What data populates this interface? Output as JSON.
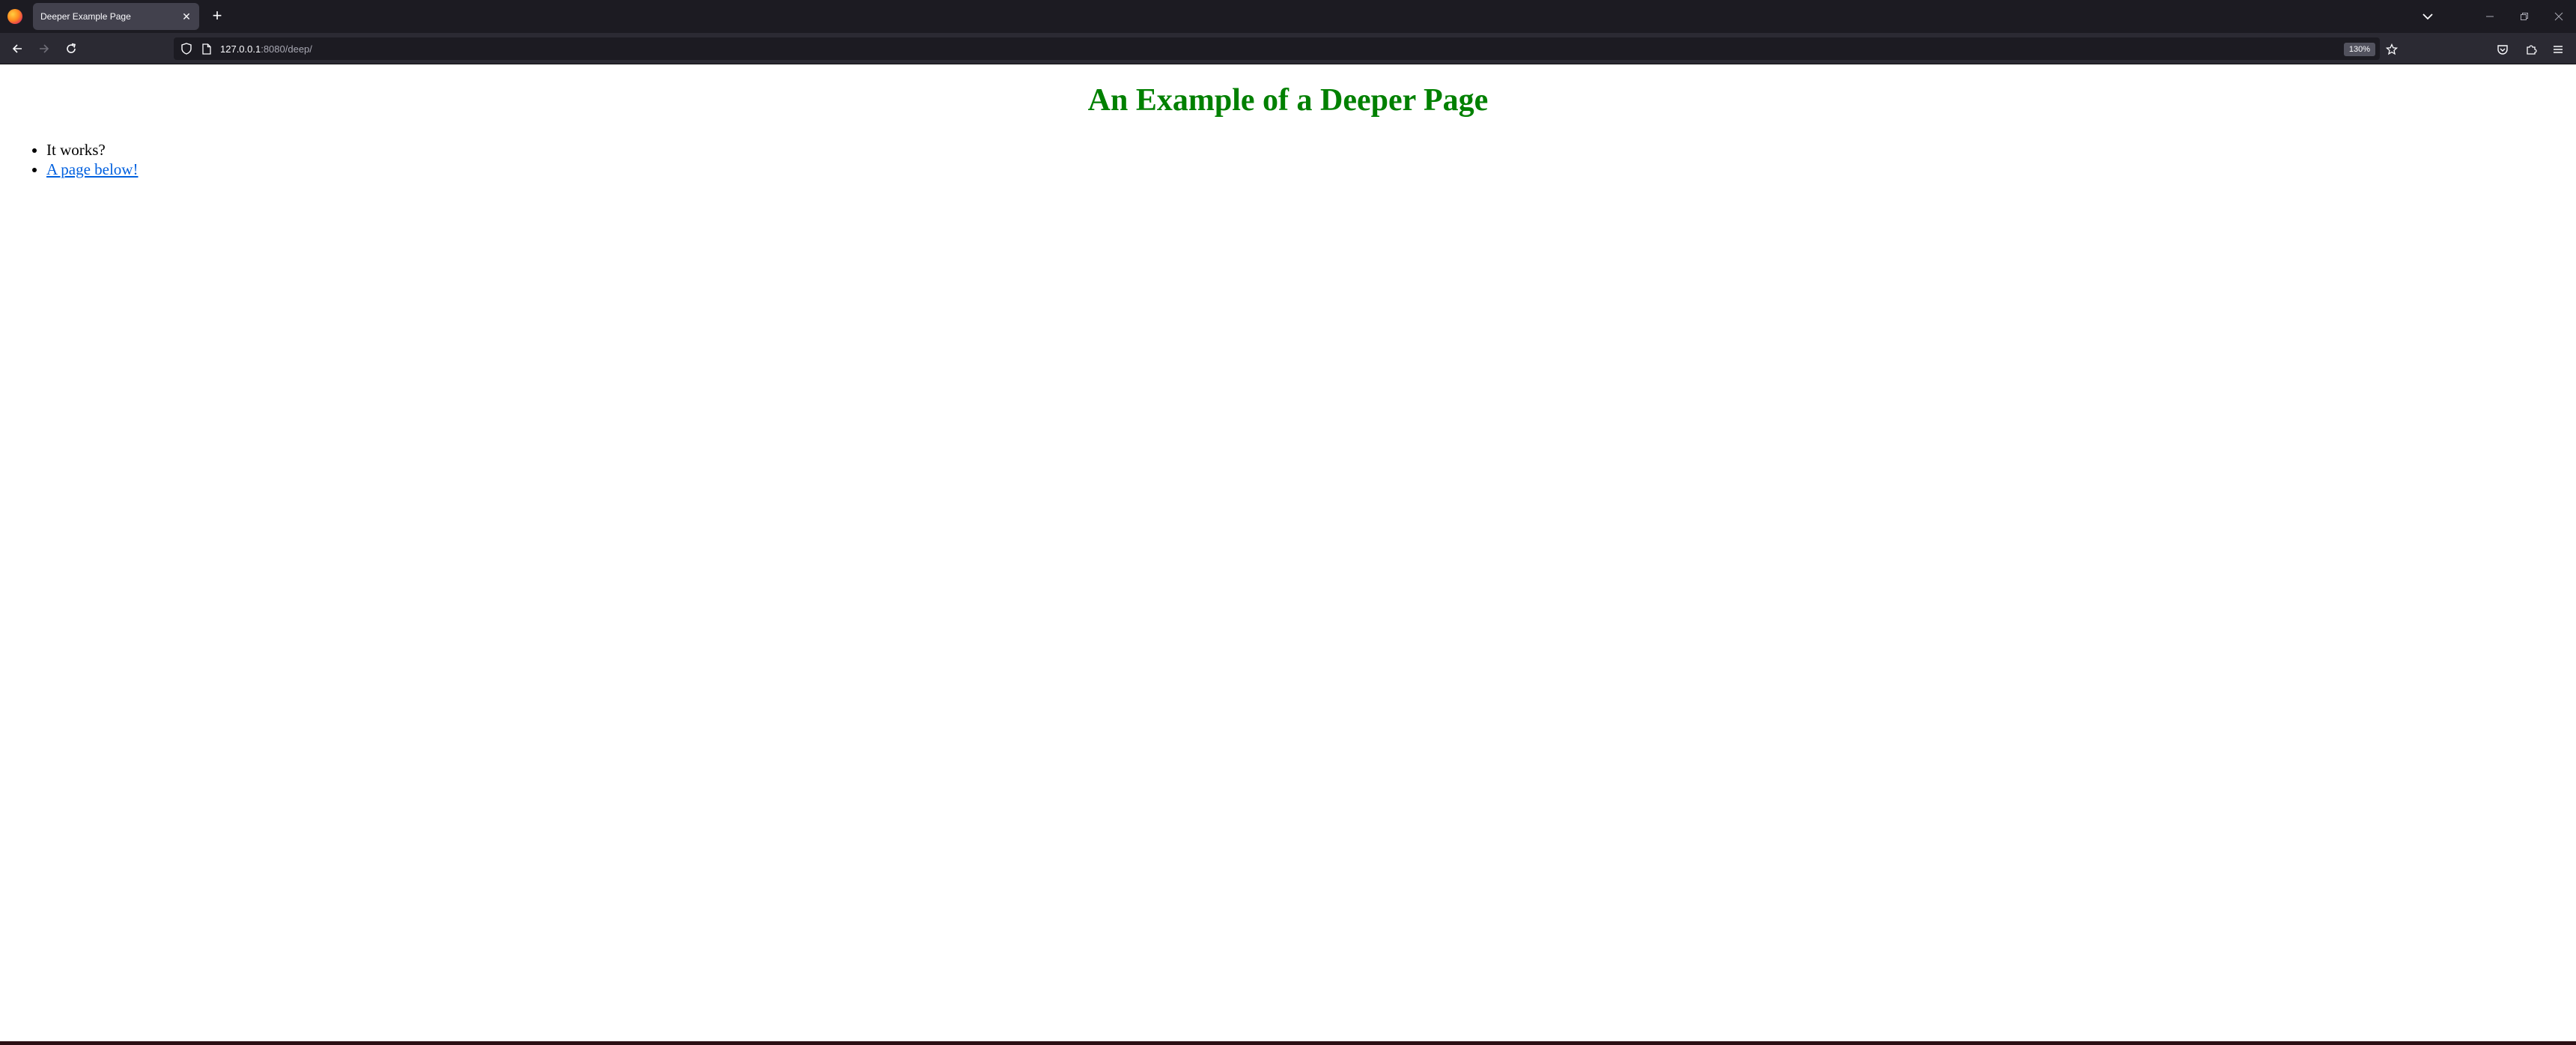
{
  "browser": {
    "tab": {
      "title": "Deeper Example Page",
      "close_label": "✕"
    },
    "new_tab_label": "+",
    "url": {
      "host": "127.0.0.1",
      "rest": ":8080/deep/"
    },
    "zoom": "130%"
  },
  "page": {
    "title": "An Example of a Deeper Page",
    "items": [
      {
        "text": "It works?"
      },
      {
        "text": "A page below!",
        "link": true
      }
    ]
  },
  "colors": {
    "title": "#008000",
    "link": "#0060df",
    "chrome_dark": "#1c1b22",
    "toolbar": "#2b2a33"
  }
}
